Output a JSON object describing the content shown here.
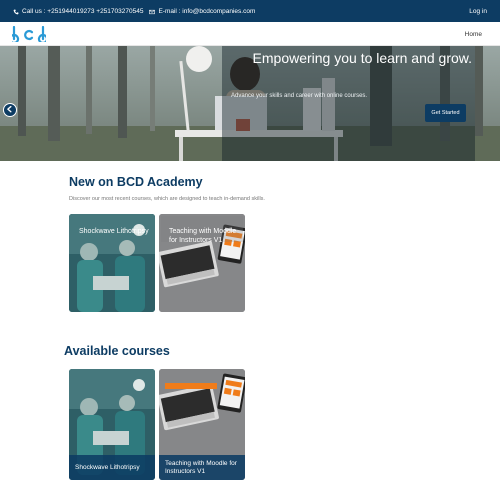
{
  "topbar": {
    "phone_label": "Call us : +251944019273 +251703270545",
    "email_label": "E-mail : info@bcdcompanies.com",
    "login_label": "Log in",
    "bg_color": "#0d3c63"
  },
  "navbar": {
    "logo_text": "bcd",
    "home_label": "Home"
  },
  "hero": {
    "heading": "Empowering you to learn and grow.",
    "subtext": "Advance your skills and career with online courses.",
    "cta_label": "Get Started",
    "prev_icon": "chevron-left-icon"
  },
  "new_section": {
    "title": "New on BCD Academy",
    "description": "Discover our most recent courses, which are designed to teach in-demand skills.",
    "cards": [
      {
        "title": "Shockwave Lithotripsy"
      },
      {
        "title": "Teaching with Moodle for Instructors V1"
      }
    ]
  },
  "available_section": {
    "title": "Available courses",
    "cards": [
      {
        "title": "Shockwave Lithotripsy"
      },
      {
        "title": "Teaching with Moodle for Instructors V1"
      }
    ]
  },
  "colors": {
    "brand": "#0d3c63",
    "logo_blue": "#2a9ad6"
  }
}
